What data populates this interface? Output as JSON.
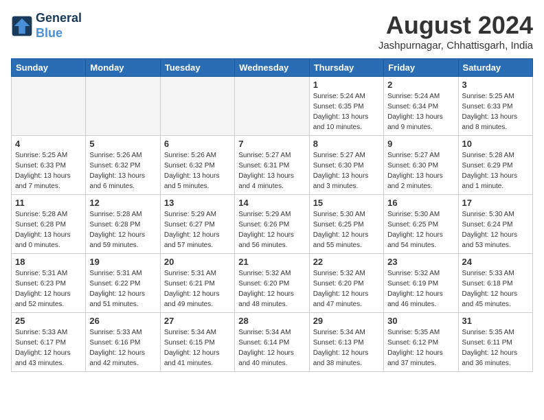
{
  "header": {
    "logo_line1": "General",
    "logo_line2": "Blue",
    "month_year": "August 2024",
    "location": "Jashpurnagar, Chhattisgarh, India"
  },
  "weekdays": [
    "Sunday",
    "Monday",
    "Tuesday",
    "Wednesday",
    "Thursday",
    "Friday",
    "Saturday"
  ],
  "weeks": [
    [
      {
        "day": "",
        "info": ""
      },
      {
        "day": "",
        "info": ""
      },
      {
        "day": "",
        "info": ""
      },
      {
        "day": "",
        "info": ""
      },
      {
        "day": "1",
        "info": "Sunrise: 5:24 AM\nSunset: 6:35 PM\nDaylight: 13 hours\nand 10 minutes."
      },
      {
        "day": "2",
        "info": "Sunrise: 5:24 AM\nSunset: 6:34 PM\nDaylight: 13 hours\nand 9 minutes."
      },
      {
        "day": "3",
        "info": "Sunrise: 5:25 AM\nSunset: 6:33 PM\nDaylight: 13 hours\nand 8 minutes."
      }
    ],
    [
      {
        "day": "4",
        "info": "Sunrise: 5:25 AM\nSunset: 6:33 PM\nDaylight: 13 hours\nand 7 minutes."
      },
      {
        "day": "5",
        "info": "Sunrise: 5:26 AM\nSunset: 6:32 PM\nDaylight: 13 hours\nand 6 minutes."
      },
      {
        "day": "6",
        "info": "Sunrise: 5:26 AM\nSunset: 6:32 PM\nDaylight: 13 hours\nand 5 minutes."
      },
      {
        "day": "7",
        "info": "Sunrise: 5:27 AM\nSunset: 6:31 PM\nDaylight: 13 hours\nand 4 minutes."
      },
      {
        "day": "8",
        "info": "Sunrise: 5:27 AM\nSunset: 6:30 PM\nDaylight: 13 hours\nand 3 minutes."
      },
      {
        "day": "9",
        "info": "Sunrise: 5:27 AM\nSunset: 6:30 PM\nDaylight: 13 hours\nand 2 minutes."
      },
      {
        "day": "10",
        "info": "Sunrise: 5:28 AM\nSunset: 6:29 PM\nDaylight: 13 hours\nand 1 minute."
      }
    ],
    [
      {
        "day": "11",
        "info": "Sunrise: 5:28 AM\nSunset: 6:28 PM\nDaylight: 13 hours\nand 0 minutes."
      },
      {
        "day": "12",
        "info": "Sunrise: 5:28 AM\nSunset: 6:28 PM\nDaylight: 12 hours\nand 59 minutes."
      },
      {
        "day": "13",
        "info": "Sunrise: 5:29 AM\nSunset: 6:27 PM\nDaylight: 12 hours\nand 57 minutes."
      },
      {
        "day": "14",
        "info": "Sunrise: 5:29 AM\nSunset: 6:26 PM\nDaylight: 12 hours\nand 56 minutes."
      },
      {
        "day": "15",
        "info": "Sunrise: 5:30 AM\nSunset: 6:25 PM\nDaylight: 12 hours\nand 55 minutes."
      },
      {
        "day": "16",
        "info": "Sunrise: 5:30 AM\nSunset: 6:25 PM\nDaylight: 12 hours\nand 54 minutes."
      },
      {
        "day": "17",
        "info": "Sunrise: 5:30 AM\nSunset: 6:24 PM\nDaylight: 12 hours\nand 53 minutes."
      }
    ],
    [
      {
        "day": "18",
        "info": "Sunrise: 5:31 AM\nSunset: 6:23 PM\nDaylight: 12 hours\nand 52 minutes."
      },
      {
        "day": "19",
        "info": "Sunrise: 5:31 AM\nSunset: 6:22 PM\nDaylight: 12 hours\nand 51 minutes."
      },
      {
        "day": "20",
        "info": "Sunrise: 5:31 AM\nSunset: 6:21 PM\nDaylight: 12 hours\nand 49 minutes."
      },
      {
        "day": "21",
        "info": "Sunrise: 5:32 AM\nSunset: 6:20 PM\nDaylight: 12 hours\nand 48 minutes."
      },
      {
        "day": "22",
        "info": "Sunrise: 5:32 AM\nSunset: 6:20 PM\nDaylight: 12 hours\nand 47 minutes."
      },
      {
        "day": "23",
        "info": "Sunrise: 5:32 AM\nSunset: 6:19 PM\nDaylight: 12 hours\nand 46 minutes."
      },
      {
        "day": "24",
        "info": "Sunrise: 5:33 AM\nSunset: 6:18 PM\nDaylight: 12 hours\nand 45 minutes."
      }
    ],
    [
      {
        "day": "25",
        "info": "Sunrise: 5:33 AM\nSunset: 6:17 PM\nDaylight: 12 hours\nand 43 minutes."
      },
      {
        "day": "26",
        "info": "Sunrise: 5:33 AM\nSunset: 6:16 PM\nDaylight: 12 hours\nand 42 minutes."
      },
      {
        "day": "27",
        "info": "Sunrise: 5:34 AM\nSunset: 6:15 PM\nDaylight: 12 hours\nand 41 minutes."
      },
      {
        "day": "28",
        "info": "Sunrise: 5:34 AM\nSunset: 6:14 PM\nDaylight: 12 hours\nand 40 minutes."
      },
      {
        "day": "29",
        "info": "Sunrise: 5:34 AM\nSunset: 6:13 PM\nDaylight: 12 hours\nand 38 minutes."
      },
      {
        "day": "30",
        "info": "Sunrise: 5:35 AM\nSunset: 6:12 PM\nDaylight: 12 hours\nand 37 minutes."
      },
      {
        "day": "31",
        "info": "Sunrise: 5:35 AM\nSunset: 6:11 PM\nDaylight: 12 hours\nand 36 minutes."
      }
    ]
  ]
}
